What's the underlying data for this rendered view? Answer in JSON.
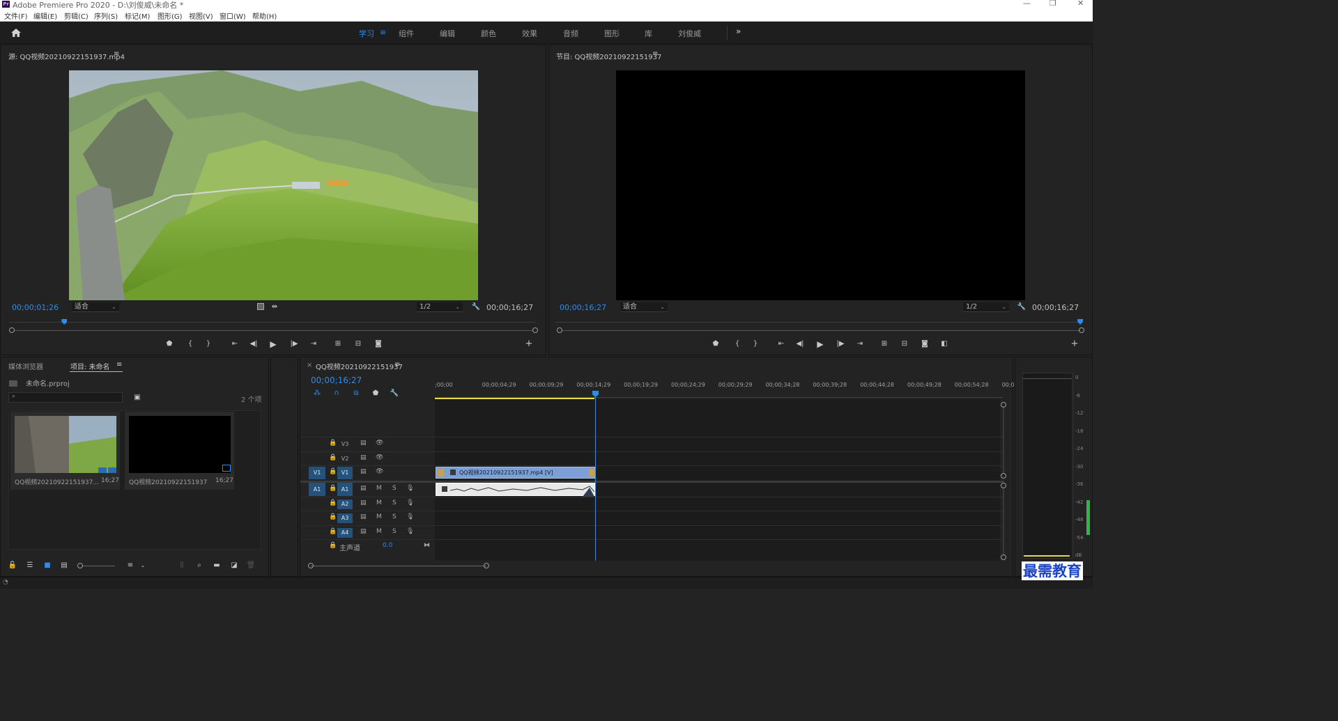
{
  "window": {
    "title": "Adobe Premiere Pro 2020 - D:\\刘俊威\\未命名 *",
    "logo_text": "Pr"
  },
  "menu": [
    "文件(F)",
    "编辑(E)",
    "剪辑(C)",
    "序列(S)",
    "标记(M)",
    "图形(G)",
    "视图(V)",
    "窗口(W)",
    "帮助(H)"
  ],
  "workspaces": {
    "items": [
      "学习",
      "组件",
      "编辑",
      "颜色",
      "效果",
      "音频",
      "图形",
      "库",
      "刘俊威"
    ],
    "active": "学习",
    "overflow": "»"
  },
  "source_monitor": {
    "title": "源: QQ视频20210922151937.mp4",
    "current_time": "00;00;01;26",
    "zoom": "适合",
    "resolution": "1/2",
    "duration": "00;00;16;27",
    "playhead_fraction": 0.105
  },
  "program_monitor": {
    "title": "节目: QQ视频20210922151937",
    "current_time": "00;00;16;27",
    "zoom": "适合",
    "resolution": "1/2",
    "duration": "00;00;16;27",
    "playhead_fraction": 0.995
  },
  "project_panel": {
    "tab_media": "媒体浏览器",
    "tab_project": "项目: 未命名",
    "project_file": "未命名.prproj",
    "search_placeholder": "",
    "item_count": "2 个项",
    "items": [
      {
        "name": "QQ视频20210922151937...",
        "duration": "16;27"
      },
      {
        "name": "QQ视频20210922151937",
        "duration": "16;27"
      }
    ]
  },
  "timeline": {
    "sequence_name": "QQ视频20210922151937",
    "current_time": "00;00;16;27",
    "ruler_labels": [
      ";00;00",
      "00;00;04;29",
      "00;00;09;29",
      "00;00;14;29",
      "00;00;19;29",
      "00;00;24;29",
      "00;00;29;29",
      "00;00;34;28",
      "00;00;39;28",
      "00;00;44;28",
      "00;00;49;28",
      "00;00;54;28",
      "00;0"
    ],
    "video_tracks": [
      "V3",
      "V2",
      "V1"
    ],
    "audio_tracks": [
      "A1",
      "A2",
      "A3",
      "A4"
    ],
    "source_patch_video": "V1",
    "source_patch_audio": "A1",
    "mute_label": "M",
    "solo_label": "S",
    "master_label": "主声道",
    "master_value": "0.0",
    "clip_label": "QQ视频20210922151937.mp4 [V]"
  },
  "audio_meter": {
    "labels": [
      "0",
      "-6",
      "-12",
      "-18",
      "-24",
      "-30",
      "-36",
      "-42",
      "-48",
      "-54",
      "dB"
    ]
  },
  "watermark": "最需教育",
  "colors": {
    "accent": "#2d8ceb",
    "clip_video": "#7c9fd6",
    "clip_audio": "#e8e8e8",
    "panel_bg": "#232323",
    "workspace_bg": "#1e1e1e"
  }
}
